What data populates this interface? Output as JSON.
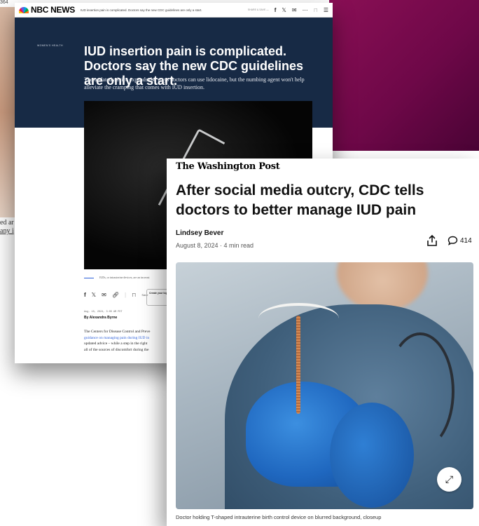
{
  "background": {
    "left_text": [
      "ed ar",
      "any i"
    ],
    "left_count": "364"
  },
  "nbc": {
    "logo": "NBC NEWS",
    "tab_title": "IUD insertion pain is complicated. Doctors say the new CDC guidelines are only a start.",
    "share_label": "SHARE & SAVE —",
    "section": "WOMEN'S HEALTH",
    "headline": "IUD insertion pain is complicated. Doctors say the new CDC guidelines are only a start.",
    "dek": "The updated advice expands the ways doctors can use lidocaine, but the numbing agent won't help alleviate the cramping that comes with IUD insertion.",
    "caption": "IUDs, or intrauterine devices, are an increasi",
    "save_label": "Save",
    "create_box": "Create your log in to sav",
    "date": "Aug. 10, 2024, 3:00 AM PDT",
    "byline": "By Alexandra Byrne",
    "body_lines": [
      {
        "text": "The Centers for Disease Control and Preve",
        "link": false
      },
      {
        "text": "guidance on managing pain during IUD in",
        "link": true
      },
      {
        "text": "updated advice – while a step in the right",
        "link": false
      },
      {
        "text": "all of the sources of discomfort during the",
        "link": false
      }
    ]
  },
  "wapo": {
    "masthead": "The Washington Post",
    "headline": "After social media outcry, CDC tells doctors to better manage IUD pain",
    "author": "Lindsey Bever",
    "meta": "August 8, 2024 · 4 min read",
    "comment_count": "414",
    "caption": "Doctor holding T-shaped intrauterine birth control device on blurred background, closeup"
  },
  "colors": {
    "nbc_navy": "#172a45",
    "magenta": "#6e0848",
    "glove_blue": "#1f67bf",
    "link_blue": "#2b5fd9"
  }
}
